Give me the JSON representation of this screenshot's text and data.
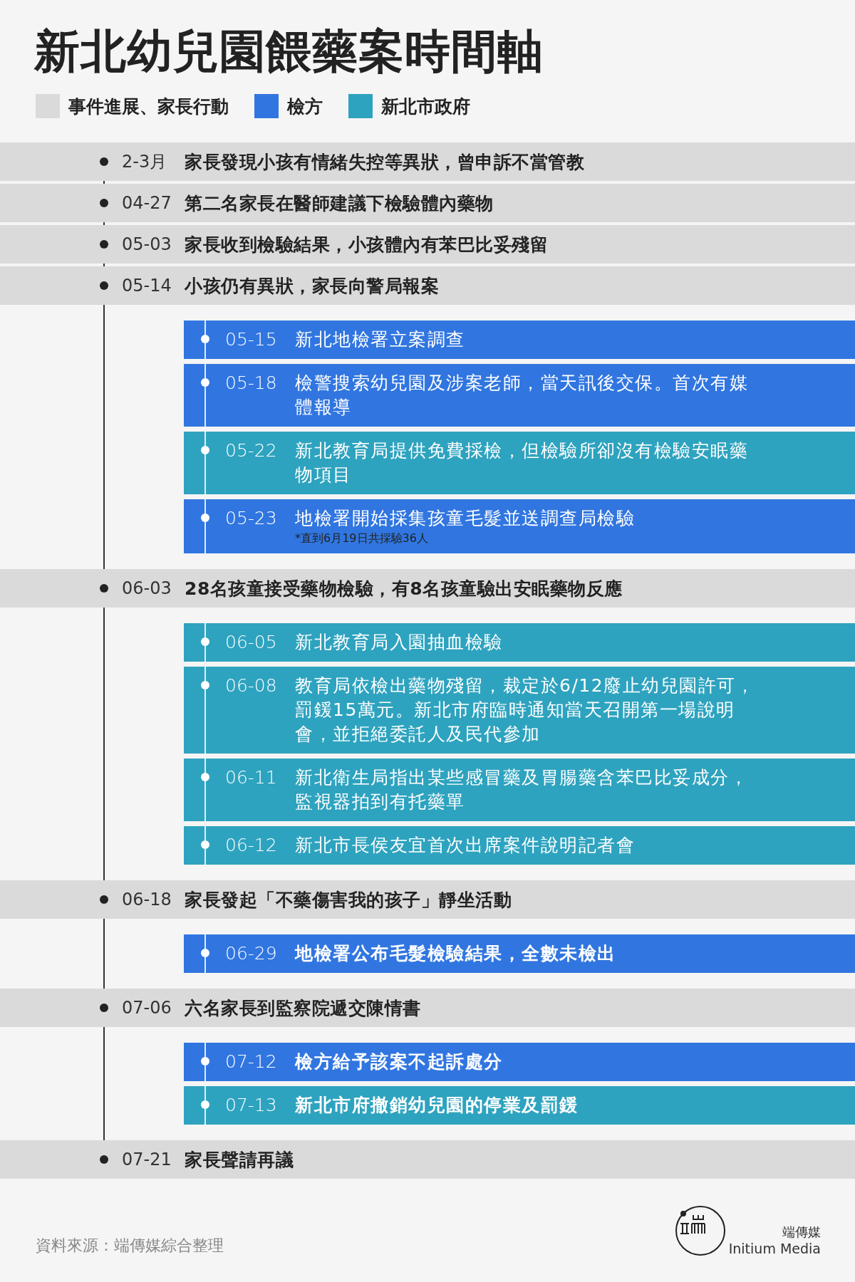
{
  "title": "新北幼兒園餵藥案時間軸",
  "legend": [
    {
      "label": "事件進展、家長行動",
      "color": "#dadada"
    },
    {
      "label": "檢方",
      "color": "#3176e0"
    },
    {
      "label": "新北市政府",
      "color": "#2ea3bf"
    }
  ],
  "timeline": [
    {
      "kind": "main",
      "date": "2-3月",
      "text": "家長發現小孩有情緒失控等異狀，曾申訴不當管教"
    },
    {
      "kind": "main",
      "date": "04-27",
      "text": "第二名家長在醫師建議下檢驗體內藥物"
    },
    {
      "kind": "main",
      "date": "05-03",
      "text": "家長收到檢驗結果，小孩體內有苯巴比妥殘留"
    },
    {
      "kind": "main",
      "date": "05-14",
      "text": "小孩仍有異狀，家長向警局報案"
    },
    {
      "kind": "group",
      "events": [
        {
          "date": "05-15",
          "text": "新北地檢署立案調查",
          "color": "#3176e0",
          "bold": false
        },
        {
          "date": "05-18",
          "text": "檢警搜索幼兒園及涉案老師，當天訊後交保。首次有媒體報導",
          "color": "#3176e0",
          "bold": false
        },
        {
          "date": "05-22",
          "text": "新北教育局提供免費採檢，但檢驗所卻沒有檢驗安眠藥物項目",
          "color": "#2ea3bf",
          "bold": false
        },
        {
          "date": "05-23",
          "text": "地檢署開始採集孩童毛髮並送調查局檢驗",
          "note": "*直到6月19日共採驗36人",
          "color": "#3176e0",
          "bold": false
        }
      ]
    },
    {
      "kind": "main",
      "date": "06-03",
      "text": "28名孩童接受藥物檢驗，有8名孩童驗出安眠藥物反應"
    },
    {
      "kind": "group",
      "events": [
        {
          "date": "06-05",
          "text": "新北教育局入園抽血檢驗",
          "color": "#2ea3bf",
          "bold": false
        },
        {
          "date": "06-08",
          "text": "教育局依檢出藥物殘留，裁定於6/12廢止幼兒園許可，罰鍰15萬元。新北市府臨時通知當天召開第一場說明會，並拒絕委託人及民代參加",
          "color": "#2ea3bf",
          "bold": false
        },
        {
          "date": "06-11",
          "text": "新北衛生局指出某些感冒藥及胃腸藥含苯巴比妥成分，監視器拍到有托藥單",
          "color": "#2ea3bf",
          "bold": false
        },
        {
          "date": "06-12",
          "text": "新北市長侯友宜首次出席案件說明記者會",
          "color": "#2ea3bf",
          "bold": false
        }
      ]
    },
    {
      "kind": "main",
      "date": "06-18",
      "text": "家長發起「不藥傷害我的孩子」靜坐活動"
    },
    {
      "kind": "group",
      "events": [
        {
          "date": "06-29",
          "text": "地檢署公布毛髮檢驗結果，全數未檢出",
          "color": "#3176e0",
          "bold": true
        }
      ]
    },
    {
      "kind": "main",
      "date": "07-06",
      "text": "六名家長到監察院遞交陳情書"
    },
    {
      "kind": "group",
      "events": [
        {
          "date": "07-12",
          "text": "檢方給予該案不起訴處分",
          "color": "#3176e0",
          "bold": true
        },
        {
          "date": "07-13",
          "text": "新北市府撤銷幼兒園的停業及罰鍰",
          "color": "#2ea3bf",
          "bold": true
        }
      ]
    },
    {
      "kind": "main",
      "date": "07-21",
      "text": "家長聲請再議"
    }
  ],
  "source": "資料來源：端傳媒綜合整理",
  "logo": {
    "name_zh": "端傳媒",
    "name_en": "Initium Media"
  }
}
